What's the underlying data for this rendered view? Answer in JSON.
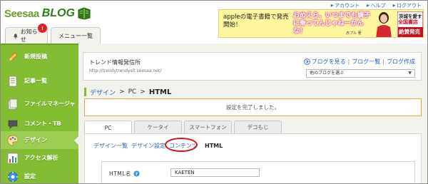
{
  "header": {
    "logo_text": "Seesaa",
    "logo_blog": "BLOG",
    "top_links": [
      "アカウント",
      "ヘルプ",
      "ログアウト"
    ],
    "tabs": {
      "notice_label": "お知らせ",
      "notice_badge": "!",
      "menu_label": "メニュー一覧"
    }
  },
  "ad": {
    "text": "appleの電子書籍で発売開始！",
    "pink_text": "おめえら、いつまでも調子に乗ってんじゃねーかんな！",
    "name": "赤プル 著",
    "badge_line1": "茨城を愛す",
    "badge_line2": "全国書店",
    "badge_line3": "絶賛発売中"
  },
  "sidebar": {
    "items": [
      {
        "label": "新規投稿",
        "icon": "pencil-icon"
      },
      {
        "label": "記事一覧",
        "icon": "document-list-icon"
      },
      {
        "label": "ファイルマネージャ",
        "icon": "file-manager-icon"
      },
      {
        "label": "コメント・TB",
        "icon": "comment-icon"
      },
      {
        "label": "デザイン",
        "icon": "palette-icon"
      },
      {
        "label": "アクセス解析",
        "icon": "bar-chart-icon"
      },
      {
        "label": "設定",
        "icon": "gear-icon"
      }
    ]
  },
  "blog": {
    "title": "トレンド情報発信所",
    "url": "http://trendytrendysit.seesaa.net/",
    "view_blog": "ブログを見る",
    "blog_list": "ブログ一覧",
    "create_blog": "ブログ作成",
    "select_label": "他のブログを選ぶ"
  },
  "breadcrumb": {
    "design": "デザイン",
    "pc": "PC",
    "current": "HTML"
  },
  "notice": "設定を完了しました。",
  "content_tabs": [
    "PC",
    "ケータイ",
    "スマートフォン",
    "デコもじ"
  ],
  "subnav": {
    "design_list": "デザイン一覧",
    "design_settings": "デザイン設定",
    "contents": "コンテンツ",
    "current": "HTML"
  },
  "form": {
    "html_name_label": "HTML名",
    "html_name_value": "KAETEN"
  },
  "colors": {
    "sidebar_green": "#84bd33",
    "link_blue": "#2a62b8",
    "highlight_red": "#d4121b",
    "notice_border": "#e3a64f"
  }
}
